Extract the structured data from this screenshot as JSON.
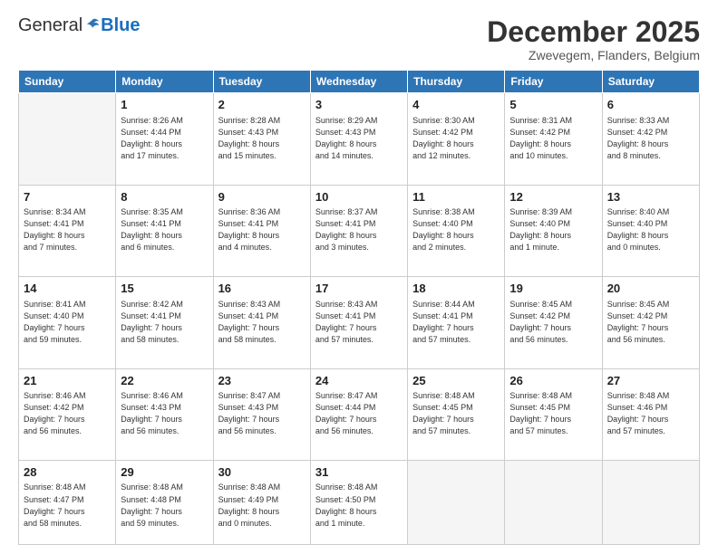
{
  "header": {
    "logo_general": "General",
    "logo_blue": "Blue",
    "month": "December 2025",
    "location": "Zwevegem, Flanders, Belgium"
  },
  "weekdays": [
    "Sunday",
    "Monday",
    "Tuesday",
    "Wednesday",
    "Thursday",
    "Friday",
    "Saturday"
  ],
  "weeks": [
    [
      {
        "day": "",
        "info": ""
      },
      {
        "day": "1",
        "info": "Sunrise: 8:26 AM\nSunset: 4:44 PM\nDaylight: 8 hours\nand 17 minutes."
      },
      {
        "day": "2",
        "info": "Sunrise: 8:28 AM\nSunset: 4:43 PM\nDaylight: 8 hours\nand 15 minutes."
      },
      {
        "day": "3",
        "info": "Sunrise: 8:29 AM\nSunset: 4:43 PM\nDaylight: 8 hours\nand 14 minutes."
      },
      {
        "day": "4",
        "info": "Sunrise: 8:30 AM\nSunset: 4:42 PM\nDaylight: 8 hours\nand 12 minutes."
      },
      {
        "day": "5",
        "info": "Sunrise: 8:31 AM\nSunset: 4:42 PM\nDaylight: 8 hours\nand 10 minutes."
      },
      {
        "day": "6",
        "info": "Sunrise: 8:33 AM\nSunset: 4:42 PM\nDaylight: 8 hours\nand 8 minutes."
      }
    ],
    [
      {
        "day": "7",
        "info": "Sunrise: 8:34 AM\nSunset: 4:41 PM\nDaylight: 8 hours\nand 7 minutes."
      },
      {
        "day": "8",
        "info": "Sunrise: 8:35 AM\nSunset: 4:41 PM\nDaylight: 8 hours\nand 6 minutes."
      },
      {
        "day": "9",
        "info": "Sunrise: 8:36 AM\nSunset: 4:41 PM\nDaylight: 8 hours\nand 4 minutes."
      },
      {
        "day": "10",
        "info": "Sunrise: 8:37 AM\nSunset: 4:41 PM\nDaylight: 8 hours\nand 3 minutes."
      },
      {
        "day": "11",
        "info": "Sunrise: 8:38 AM\nSunset: 4:40 PM\nDaylight: 8 hours\nand 2 minutes."
      },
      {
        "day": "12",
        "info": "Sunrise: 8:39 AM\nSunset: 4:40 PM\nDaylight: 8 hours\nand 1 minute."
      },
      {
        "day": "13",
        "info": "Sunrise: 8:40 AM\nSunset: 4:40 PM\nDaylight: 8 hours\nand 0 minutes."
      }
    ],
    [
      {
        "day": "14",
        "info": "Sunrise: 8:41 AM\nSunset: 4:40 PM\nDaylight: 7 hours\nand 59 minutes."
      },
      {
        "day": "15",
        "info": "Sunrise: 8:42 AM\nSunset: 4:41 PM\nDaylight: 7 hours\nand 58 minutes."
      },
      {
        "day": "16",
        "info": "Sunrise: 8:43 AM\nSunset: 4:41 PM\nDaylight: 7 hours\nand 58 minutes."
      },
      {
        "day": "17",
        "info": "Sunrise: 8:43 AM\nSunset: 4:41 PM\nDaylight: 7 hours\nand 57 minutes."
      },
      {
        "day": "18",
        "info": "Sunrise: 8:44 AM\nSunset: 4:41 PM\nDaylight: 7 hours\nand 57 minutes."
      },
      {
        "day": "19",
        "info": "Sunrise: 8:45 AM\nSunset: 4:42 PM\nDaylight: 7 hours\nand 56 minutes."
      },
      {
        "day": "20",
        "info": "Sunrise: 8:45 AM\nSunset: 4:42 PM\nDaylight: 7 hours\nand 56 minutes."
      }
    ],
    [
      {
        "day": "21",
        "info": "Sunrise: 8:46 AM\nSunset: 4:42 PM\nDaylight: 7 hours\nand 56 minutes."
      },
      {
        "day": "22",
        "info": "Sunrise: 8:46 AM\nSunset: 4:43 PM\nDaylight: 7 hours\nand 56 minutes."
      },
      {
        "day": "23",
        "info": "Sunrise: 8:47 AM\nSunset: 4:43 PM\nDaylight: 7 hours\nand 56 minutes."
      },
      {
        "day": "24",
        "info": "Sunrise: 8:47 AM\nSunset: 4:44 PM\nDaylight: 7 hours\nand 56 minutes."
      },
      {
        "day": "25",
        "info": "Sunrise: 8:48 AM\nSunset: 4:45 PM\nDaylight: 7 hours\nand 57 minutes."
      },
      {
        "day": "26",
        "info": "Sunrise: 8:48 AM\nSunset: 4:45 PM\nDaylight: 7 hours\nand 57 minutes."
      },
      {
        "day": "27",
        "info": "Sunrise: 8:48 AM\nSunset: 4:46 PM\nDaylight: 7 hours\nand 57 minutes."
      }
    ],
    [
      {
        "day": "28",
        "info": "Sunrise: 8:48 AM\nSunset: 4:47 PM\nDaylight: 7 hours\nand 58 minutes."
      },
      {
        "day": "29",
        "info": "Sunrise: 8:48 AM\nSunset: 4:48 PM\nDaylight: 7 hours\nand 59 minutes."
      },
      {
        "day": "30",
        "info": "Sunrise: 8:48 AM\nSunset: 4:49 PM\nDaylight: 8 hours\nand 0 minutes."
      },
      {
        "day": "31",
        "info": "Sunrise: 8:48 AM\nSunset: 4:50 PM\nDaylight: 8 hours\nand 1 minute."
      },
      {
        "day": "",
        "info": ""
      },
      {
        "day": "",
        "info": ""
      },
      {
        "day": "",
        "info": ""
      }
    ]
  ]
}
